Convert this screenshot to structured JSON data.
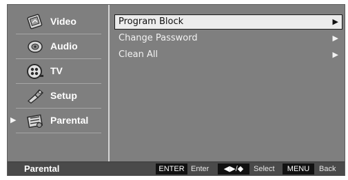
{
  "sidebar": {
    "items": [
      {
        "label": "Video",
        "icon": "video-icon",
        "selected": false
      },
      {
        "label": "Audio",
        "icon": "audio-icon",
        "selected": false
      },
      {
        "label": "TV",
        "icon": "tv-icon",
        "selected": false
      },
      {
        "label": "Setup",
        "icon": "setup-icon",
        "selected": false
      },
      {
        "label": "Parental",
        "icon": "parental-icon",
        "selected": true
      }
    ],
    "active_marker": "▶"
  },
  "menu": {
    "items": [
      {
        "label": "Program Block",
        "arrow": "▶",
        "selected": true
      },
      {
        "label": "Change Password",
        "arrow": "▶",
        "selected": false
      },
      {
        "label": "Clean All",
        "arrow": "▶",
        "selected": false
      }
    ]
  },
  "bottombar": {
    "title": "Parental",
    "enter_key": "ENTER",
    "enter_label": "Enter",
    "nav_key": "◀▶/◆",
    "nav_label": "Select",
    "menu_key": "MENU",
    "menu_label": "Back"
  },
  "colors": {
    "panel": "#7f7f7f",
    "bar": "#4a4a4a",
    "selection": "#ececec"
  }
}
